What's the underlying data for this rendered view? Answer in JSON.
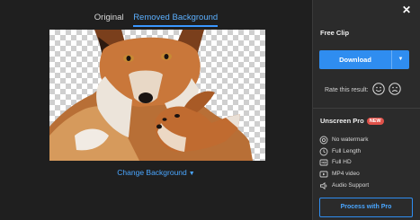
{
  "tabs": [
    {
      "label": "Original",
      "active": false
    },
    {
      "label": "Removed Background",
      "active": true
    }
  ],
  "change_background": {
    "label": "Change Background",
    "icon": "chevron-down-icon"
  },
  "panel": {
    "close_icon": "close-icon",
    "free_clip": "Free Clip",
    "download_label": "Download",
    "dropdown_icon": "caret-down-icon",
    "rate_label": "Rate this result:",
    "rating_icons": [
      "happy-face-icon",
      "sad-face-icon"
    ],
    "pro_title": "Unscreen Pro",
    "pro_badge": "NEW",
    "features": [
      {
        "label": "No watermark",
        "icon": "no-watermark-icon"
      },
      {
        "label": "Full Length",
        "icon": "clock-icon"
      },
      {
        "label": "Full HD",
        "icon": "hd-icon"
      },
      {
        "label": "MP4 video",
        "icon": "video-icon"
      },
      {
        "label": "Audio Support",
        "icon": "speaker-icon"
      }
    ],
    "process_pro_label": "Process with Pro"
  },
  "colors": {
    "background": "#1f1f1f",
    "panel": "#2b2b2b",
    "accent": "#2f8df0",
    "link": "#4aa6ff",
    "badge": "#e0524a"
  }
}
